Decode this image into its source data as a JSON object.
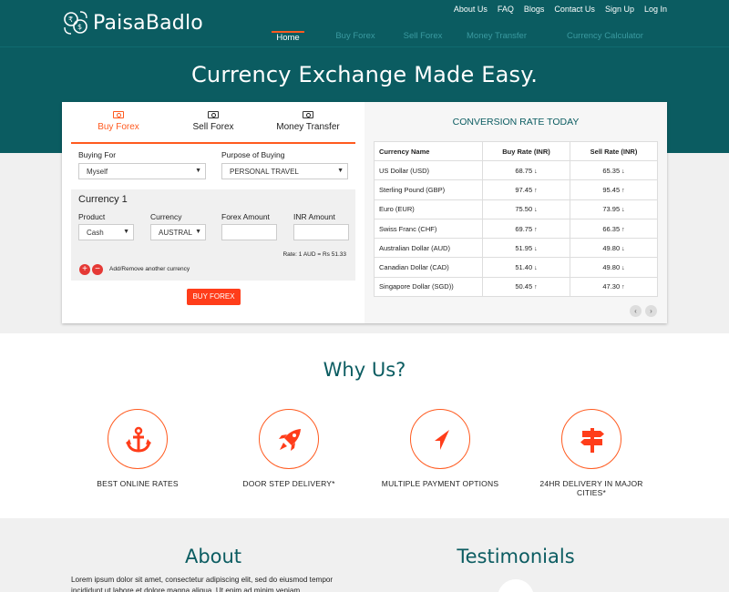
{
  "brand": {
    "name": "PaisaBadlo"
  },
  "top_links": [
    "About Us",
    "FAQ",
    "Blogs",
    "Contact Us",
    "Sign Up",
    "Log In"
  ],
  "main_nav": [
    {
      "label": "Home",
      "active": true
    },
    {
      "label": "Buy Forex",
      "active": false
    },
    {
      "label": "Sell Forex",
      "active": false
    },
    {
      "label": "Money Transfer",
      "active": false
    },
    {
      "label": "Currency Calculator",
      "active": false
    }
  ],
  "hero": {
    "title": "Currency Exchange Made Easy."
  },
  "form": {
    "tabs": [
      "Buy Forex",
      "Sell Forex",
      "Money Transfer"
    ],
    "buying_for_label": "Buying For",
    "buying_for_value": "Myself",
    "purpose_label": "Purpose of Buying",
    "purpose_value": "PERSONAL TRAVEL",
    "currency_block_title": "Currency 1",
    "product_label": "Product",
    "product_value": "Cash",
    "currency_label": "Currency",
    "currency_value": "AUSTRAL",
    "forex_amount_label": "Forex Amount",
    "inr_amount_label": "INR Amount",
    "rate_note": "Rate: 1 AUD = Rs 51.33",
    "add_remove_label": "Add/Remove another currency",
    "submit_label": "BUY FOREX"
  },
  "rates": {
    "title": "CONVERSION RATE TODAY",
    "headers": [
      "Currency Name",
      "Buy Rate (INR)",
      "Sell Rate (INR)"
    ],
    "rows": [
      {
        "name": "US Dollar (USD)",
        "buy": "68.75",
        "buy_dir": "down",
        "sell": "65.35",
        "sell_dir": "down"
      },
      {
        "name": "Sterling Pound (GBP)",
        "buy": "97.45",
        "buy_dir": "up",
        "sell": "95.45",
        "sell_dir": "up"
      },
      {
        "name": "Euro (EUR)",
        "buy": "75.50",
        "buy_dir": "down",
        "sell": "73.95",
        "sell_dir": "down"
      },
      {
        "name": "Swiss Franc (CHF)",
        "buy": "69.75",
        "buy_dir": "up",
        "sell": "66.35",
        "sell_dir": "up"
      },
      {
        "name": "Australian Dollar (AUD)",
        "buy": "51.95",
        "buy_dir": "down",
        "sell": "49.80",
        "sell_dir": "down"
      },
      {
        "name": "Canadian Dollar (CAD)",
        "buy": "51.40",
        "buy_dir": "down",
        "sell": "49.80",
        "sell_dir": "down"
      },
      {
        "name": "Singapore Dollar (SGD))",
        "buy": "50.45",
        "buy_dir": "up",
        "sell": "47.30",
        "sell_dir": "up"
      }
    ]
  },
  "why": {
    "title": "Why Us?",
    "features": [
      {
        "label": "BEST ONLINE RATES",
        "icon": "anchor-icon"
      },
      {
        "label": "DOOR STEP DELIVERY*",
        "icon": "rocket-icon"
      },
      {
        "label": "MULTIPLE PAYMENT OPTIONS",
        "icon": "navigation-arrow-icon"
      },
      {
        "label": "24HR DELIVERY IN MAJOR CITIES*",
        "icon": "signpost-icon"
      }
    ]
  },
  "about": {
    "title": "About",
    "text": "Lorem ipsum dolor sit amet, consectetur adipiscing elit, sed do eiusmod tempor incididunt ut labore et dolore magna aliqua. Ut enim ad minim veniam"
  },
  "testimonials": {
    "title": "Testimonials"
  },
  "colors": {
    "teal": "#0b5c61",
    "accent": "#ff5a1f",
    "button": "#ff3d1a"
  }
}
